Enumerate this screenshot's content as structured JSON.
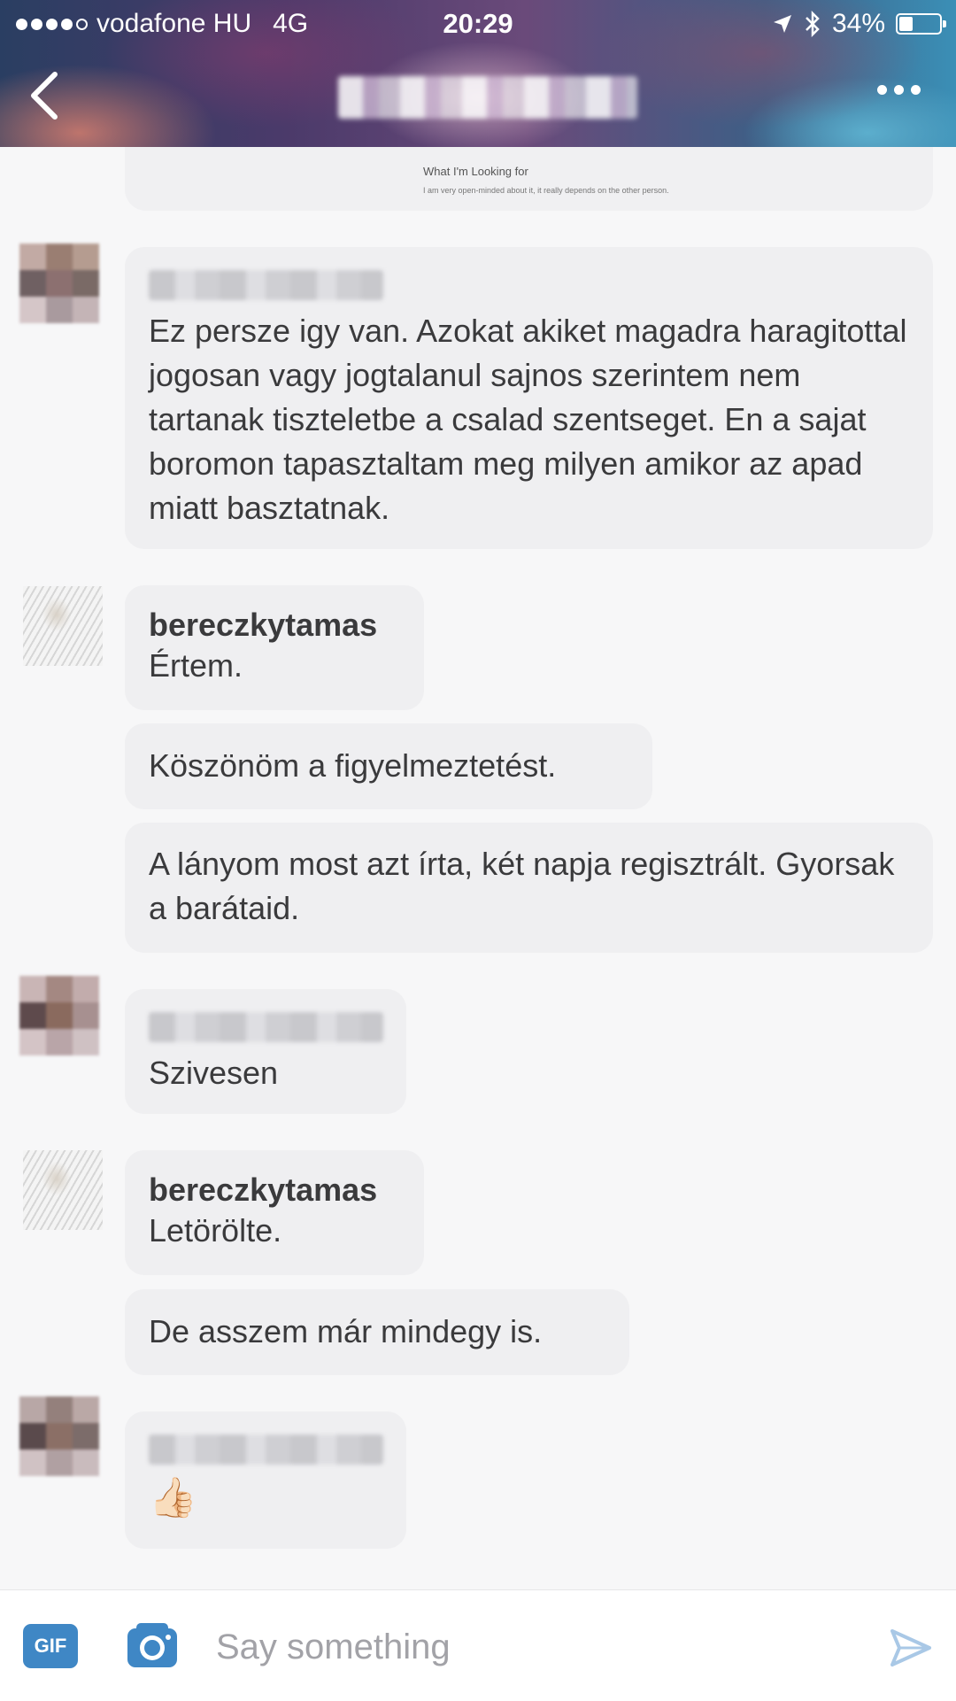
{
  "status_bar": {
    "carrier": "vodafone HU",
    "network": "4G",
    "time": "20:29",
    "battery": "34%",
    "battery_level": 0.34
  },
  "header": {
    "back_icon": "chevron-left-icon",
    "more_icon": "more-horizontal-icon"
  },
  "profile_snippet": {
    "heading": "What I'm Looking for",
    "text": "I am very open-minded about it, it really depends on the other person."
  },
  "messages": [
    {
      "text": "Ez persze igy van. Azokat akiket magadra haragitottal jogosan vagy jogtalanul sajnos szerintem nem tartanak tiszteletbe a csalad szentseget. En a sajat boromon tapasztaltam meg milyen amikor az apad miatt basztatnak."
    },
    {
      "sender": "bereczkytamas",
      "text": "Értem."
    },
    {
      "text": "Köszönöm a figyelmeztetést."
    },
    {
      "text": "A lányom most azt írta, két napja regisztrált. Gyorsak a barátaid."
    },
    {
      "text": "Szivesen"
    },
    {
      "sender": "bereczkytamas",
      "text": "Letörölte."
    },
    {
      "text": "De asszem már mindegy is."
    },
    {
      "text": "👍🏻"
    }
  ],
  "input_bar": {
    "gif_label": "GIF",
    "placeholder": "Say something",
    "camera_icon": "camera-icon",
    "send_icon": "send-icon"
  },
  "colors": {
    "bubble": "#efeff1",
    "background": "#f7f7f8",
    "gif_button": "#3f87c5",
    "send_icon": "#a9c8e6"
  }
}
